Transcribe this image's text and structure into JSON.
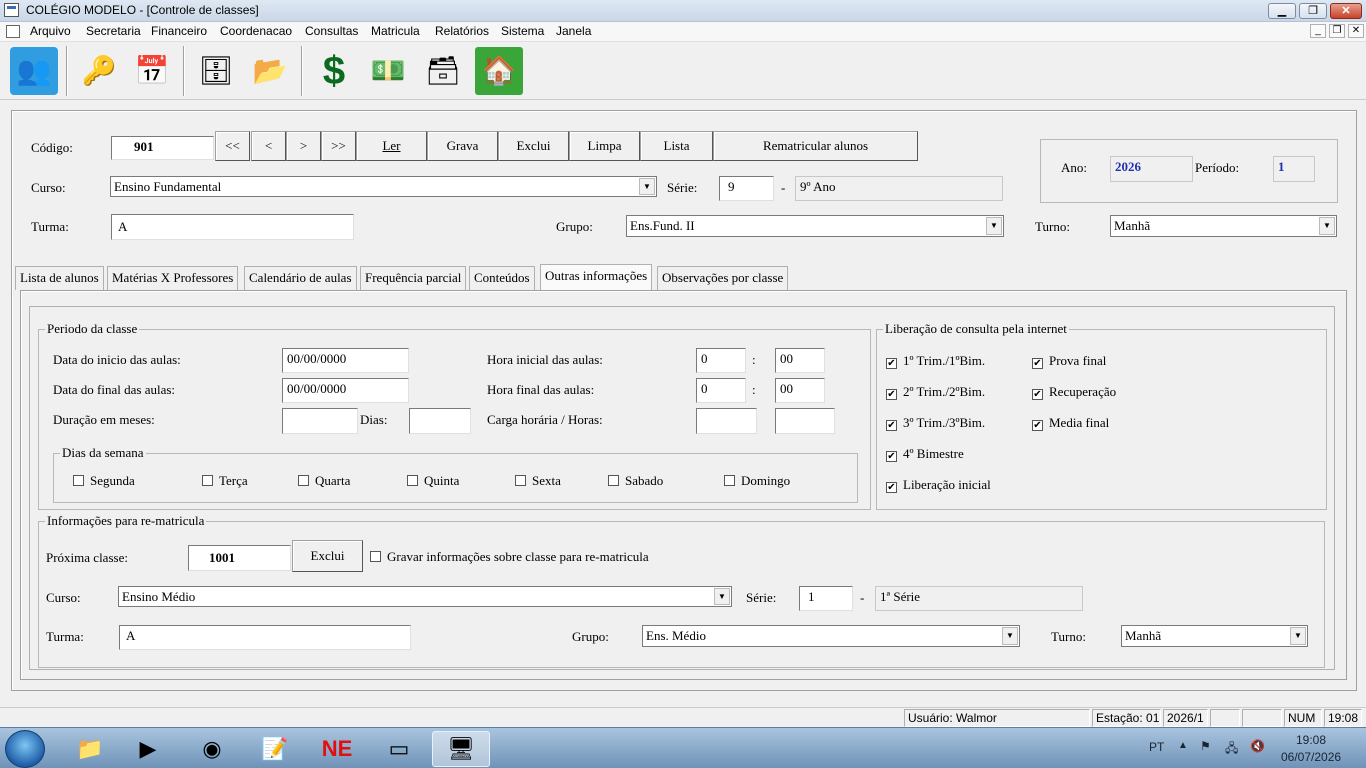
{
  "window": {
    "title": "COLÉGIO MODELO - [Controle de classes]",
    "min": "▁",
    "max": "❐",
    "close": "✕"
  },
  "menu": [
    "Arquivo",
    "Secretaria",
    "Financeiro",
    "Coordenacao",
    "Consultas",
    "Matricula",
    "Relatórios",
    "Sistema",
    "Janela"
  ],
  "toolbar": [
    {
      "icon": "contacts-icon",
      "glyph": "👥"
    },
    {
      "icon": "keys-icon",
      "glyph": "🔑"
    },
    {
      "icon": "calendar-icon",
      "glyph": "📅"
    },
    {
      "icon": "file-cabinet-icon",
      "glyph": "🗄"
    },
    {
      "icon": "documents-icon",
      "glyph": "📂"
    },
    {
      "icon": "dollar-icon",
      "glyph": "$"
    },
    {
      "icon": "money-icon",
      "glyph": "💵"
    },
    {
      "icon": "file-cabinet-m-icon",
      "glyph": "🗃"
    },
    {
      "icon": "home-icon",
      "glyph": "🏠"
    }
  ],
  "header": {
    "codigo_label": "Código:",
    "codigo": "901",
    "nav": [
      "<<",
      "<",
      ">",
      ">>"
    ],
    "actions": [
      "Ler",
      "Grava",
      "Exclui",
      "Limpa",
      "Lista"
    ],
    "rematricular": "Rematricular alunos",
    "curso_label": "Curso:",
    "curso": "Ensino Fundamental",
    "serie_label": "Série:",
    "serie": "9",
    "dash": "-",
    "serie_desc": "9º Ano",
    "turma_label": "Turma:",
    "turma": "A",
    "grupo_label": "Grupo:",
    "grupo": "Ens.Fund. II",
    "turno_label": "Turno:",
    "turno": "Manhã",
    "ano_label": "Ano:",
    "ano": "2026",
    "periodo_label": "Período:",
    "periodo": "1"
  },
  "tabs": [
    "Lista de alunos",
    "Matérias X Professores",
    "Calendário de aulas",
    "Frequência parcial",
    "Conteúdos",
    "Outras informações",
    "Observações por classe"
  ],
  "active_tab": 5,
  "periodo": {
    "title": "Periodo da classe",
    "inicio_label": "Data do inicio das aulas:",
    "inicio": "00/00/0000",
    "final_label": "Data do final das aulas:",
    "final": "00/00/0000",
    "duracao_label": "Duração em meses:",
    "duracao": "",
    "dias_label": "Dias:",
    "dias": "",
    "hora_ini_label": "Hora inicial das aulas:",
    "hora_ini_h": "0",
    "hora_ini_m": "00",
    "hora_fim_label": "Hora final das aulas:",
    "hora_fim_h": "0",
    "hora_fim_m": "00",
    "carga_label": "Carga horária / Horas:",
    "carga_1": "",
    "carga_2": "",
    "colon": ":",
    "dias_semana_title": "Dias da semana",
    "dias_semana": [
      "Segunda",
      "Terça",
      "Quarta",
      "Quinta",
      "Sexta",
      "Sabado",
      "Domingo"
    ]
  },
  "liberacao": {
    "title": "Liberação de consulta pela internet",
    "left": [
      {
        "label": "1º Trim./1ºBim.",
        "checked": true
      },
      {
        "label": "2º Trim./2ºBim.",
        "checked": true
      },
      {
        "label": "3º Trim./3ºBim.",
        "checked": true
      },
      {
        "label": "4º Bimestre",
        "checked": true
      },
      {
        "label": "Liberação inicial",
        "checked": true
      }
    ],
    "right": [
      {
        "label": "Prova final",
        "checked": true
      },
      {
        "label": "Recuperação",
        "checked": true
      },
      {
        "label": "Media final",
        "checked": true
      }
    ]
  },
  "rematricula": {
    "title": "Informações para re-matricula",
    "proxima_label": "Próxima classe:",
    "proxima": "1001",
    "exclui": "Exclui",
    "gravar_label": "Gravar informações sobre classe para re-matricula",
    "gravar": false,
    "curso_label": "Curso:",
    "curso": "Ensino Médio",
    "serie_label": "Série:",
    "serie": "1",
    "dash": "-",
    "serie_desc": "1ª Série",
    "turma_label": "Turma:",
    "turma": "A",
    "grupo_label": "Grupo:",
    "grupo": "Ens. Médio",
    "turno_label": "Turno:",
    "turno": "Manhã"
  },
  "status": {
    "usuario": "Usuário: Walmor",
    "estacao": "Estação: 01",
    "periodo": "2026/1",
    "num": "NUM",
    "hora": "19:08"
  },
  "taskbar": {
    "lang": "PT",
    "time": "19:08",
    "date": "06/07/2026"
  }
}
